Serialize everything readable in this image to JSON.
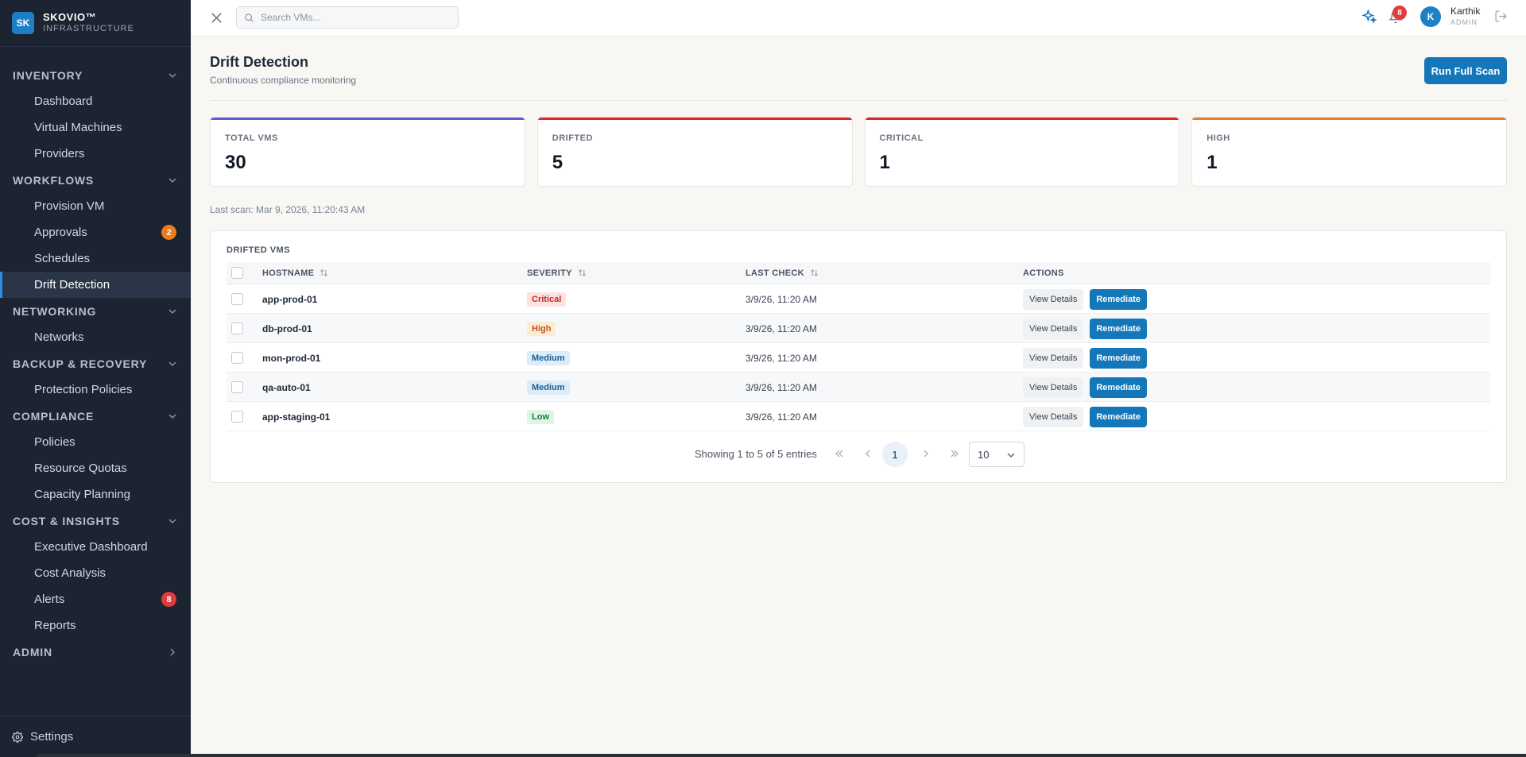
{
  "brand": {
    "logo_text": "SK",
    "name": "SKOVIO™",
    "subtitle": "INFRASTRUCTURE"
  },
  "sidebar": {
    "sections": [
      {
        "title": "INVENTORY",
        "items": [
          {
            "label": "Dashboard"
          },
          {
            "label": "Virtual Machines"
          },
          {
            "label": "Providers"
          }
        ]
      },
      {
        "title": "WORKFLOWS",
        "items": [
          {
            "label": "Provision VM"
          },
          {
            "label": "Approvals",
            "badge": "2"
          },
          {
            "label": "Schedules"
          },
          {
            "label": "Drift Detection",
            "active": true
          }
        ]
      },
      {
        "title": "NETWORKING",
        "items": [
          {
            "label": "Networks"
          }
        ]
      },
      {
        "title": "BACKUP & RECOVERY",
        "items": [
          {
            "label": "Protection Policies"
          }
        ]
      },
      {
        "title": "COMPLIANCE",
        "items": [
          {
            "label": "Policies"
          },
          {
            "label": "Resource Quotas"
          },
          {
            "label": "Capacity Planning"
          }
        ]
      },
      {
        "title": "COST & INSIGHTS",
        "items": [
          {
            "label": "Executive Dashboard"
          },
          {
            "label": "Cost Analysis"
          },
          {
            "label": "Alerts",
            "badge": "8"
          },
          {
            "label": "Reports"
          }
        ]
      },
      {
        "title": "ADMIN",
        "items": []
      }
    ],
    "settings_label": "Settings"
  },
  "header": {
    "search_placeholder": "Search VMs...",
    "notification_count": "8",
    "user": {
      "initial": "K",
      "name": "Karthik",
      "role": "ADMIN"
    }
  },
  "page": {
    "title": "Drift Detection",
    "subtitle": "Continuous compliance monitoring",
    "scan_button": "Run Full Scan",
    "last_scan": "Last scan: Mar 9, 2026, 11:20:43 AM"
  },
  "stats": [
    {
      "label": "TOTAL VMS",
      "value": "30",
      "color": "#5b5bd6"
    },
    {
      "label": "DRIFTED",
      "value": "5",
      "color": "#dc2626"
    },
    {
      "label": "CRITICAL",
      "value": "1",
      "color": "#dc2626"
    },
    {
      "label": "HIGH",
      "value": "1",
      "color": "#e67e22"
    }
  ],
  "table": {
    "title": "DRIFTED VMS",
    "columns": {
      "hostname": "HOSTNAME",
      "severity": "SEVERITY",
      "last_check": "LAST CHECK",
      "actions": "ACTIONS"
    },
    "view_label": "View Details",
    "remediate_label": "Remediate",
    "rows": [
      {
        "hostname": "app-prod-01",
        "severity": "Critical",
        "last_check": "3/9/26, 11:20 AM"
      },
      {
        "hostname": "db-prod-01",
        "severity": "High",
        "last_check": "3/9/26, 11:20 AM"
      },
      {
        "hostname": "mon-prod-01",
        "severity": "Medium",
        "last_check": "3/9/26, 11:20 AM"
      },
      {
        "hostname": "qa-auto-01",
        "severity": "Medium",
        "last_check": "3/9/26, 11:20 AM"
      },
      {
        "hostname": "app-staging-01",
        "severity": "Low",
        "last_check": "3/9/26, 11:20 AM"
      }
    ],
    "severity_colors": {
      "Critical": {
        "bg": "#fde2e2",
        "fg": "#c62828"
      },
      "High": {
        "bg": "#fdebd3",
        "fg": "#c05621"
      },
      "Medium": {
        "bg": "#dcecf8",
        "fg": "#1c5f94"
      },
      "Low": {
        "bg": "#dcf5e4",
        "fg": "#1e7a3c"
      }
    }
  },
  "pagination": {
    "summary": "Showing 1 to 5 of 5 entries",
    "current_page": "1",
    "page_size": "10"
  }
}
